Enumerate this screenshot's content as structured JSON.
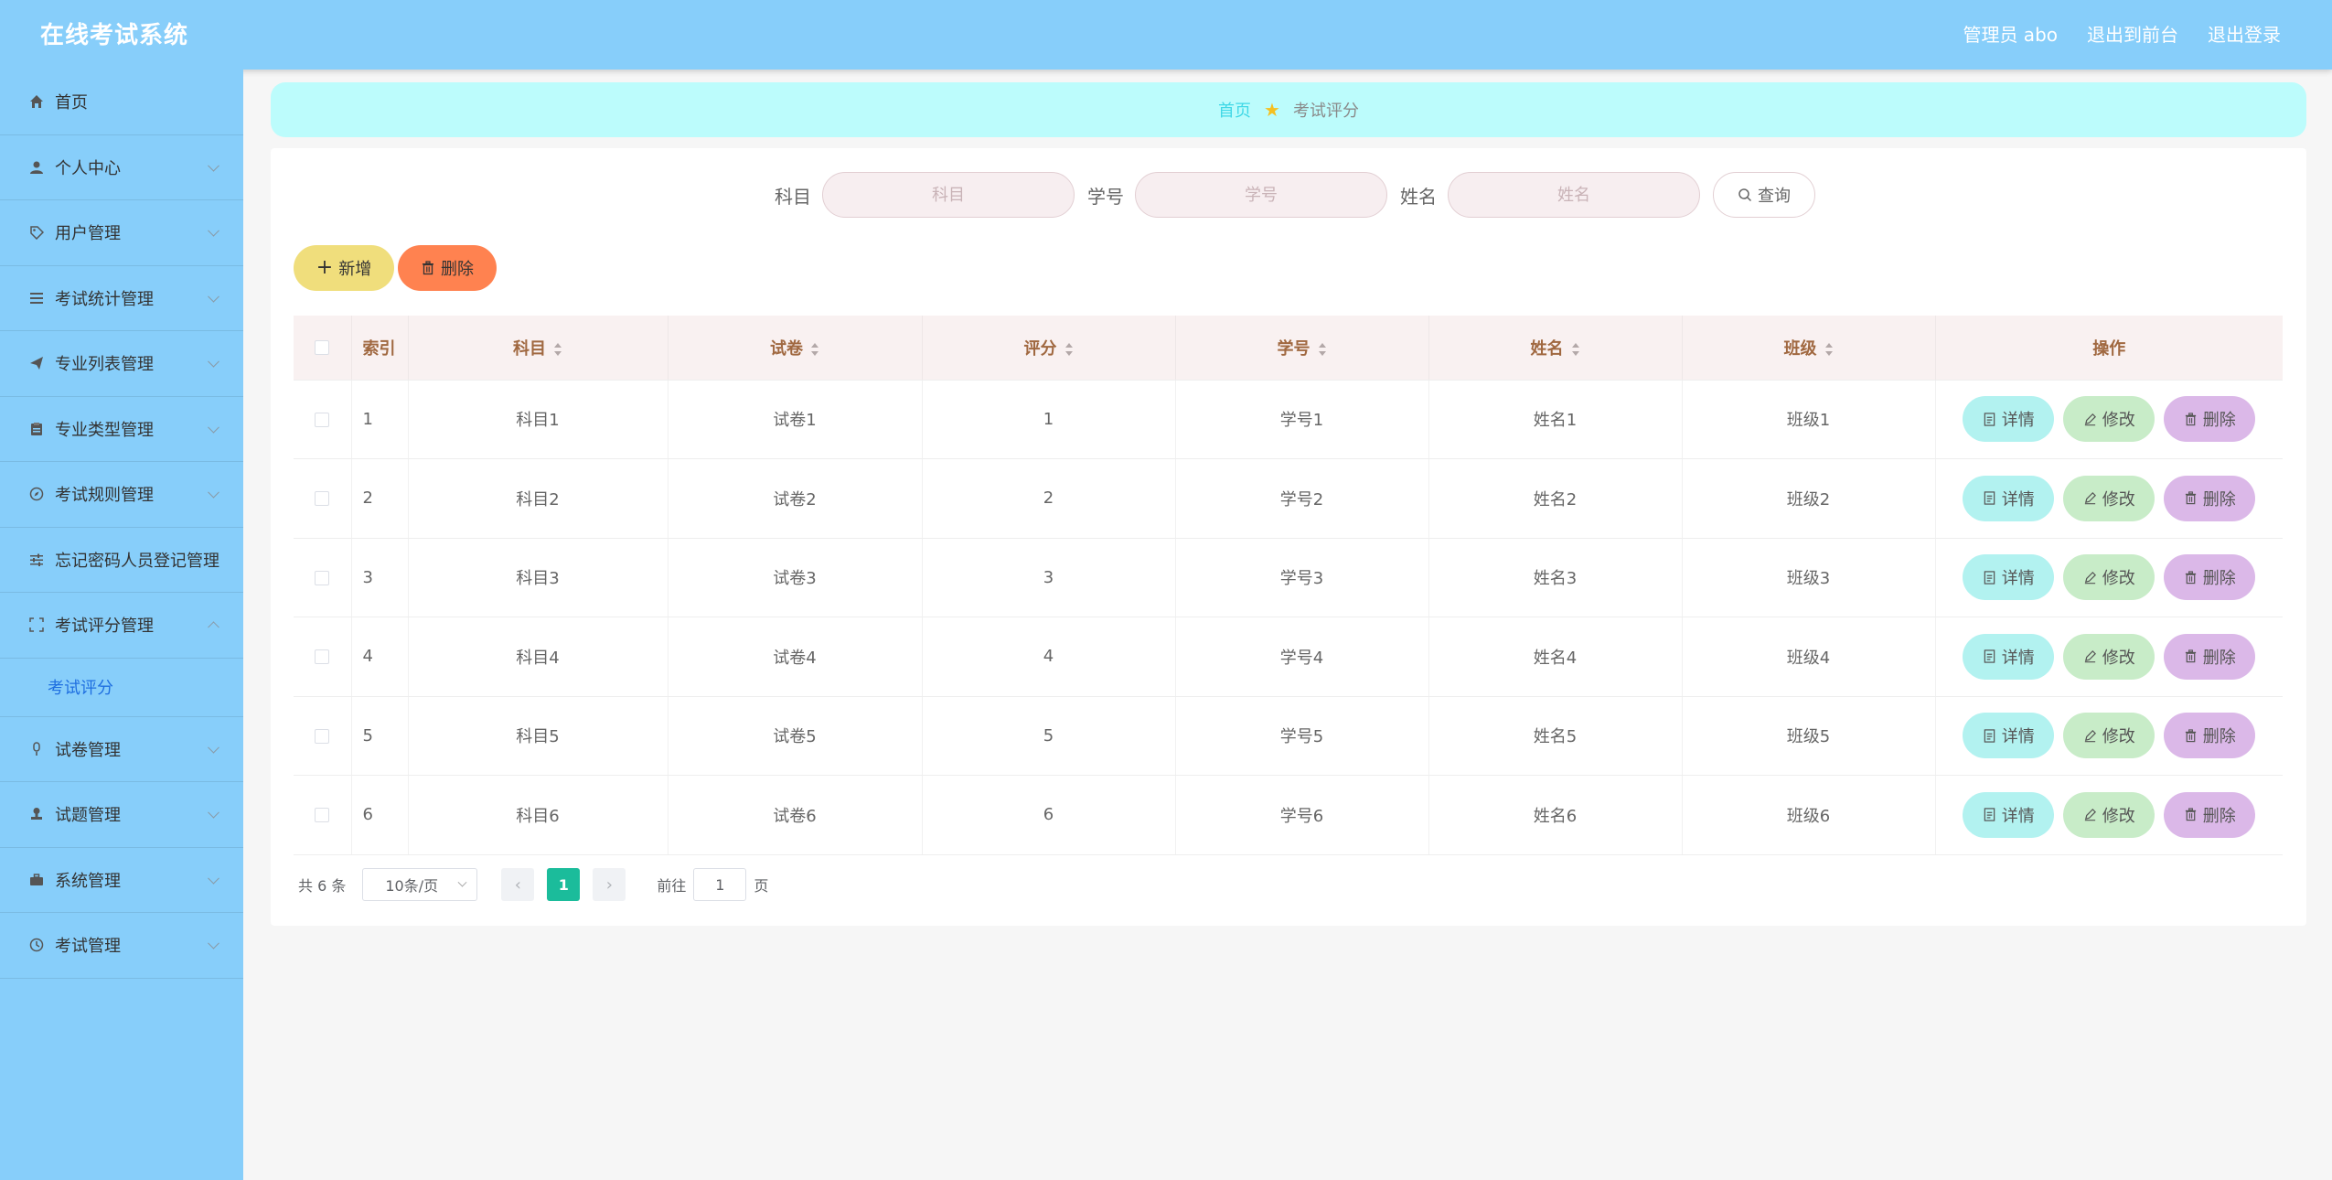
{
  "header": {
    "title": "在线考试系统",
    "admin": "管理员 abo",
    "to_front": "退出到前台",
    "logout": "退出登录"
  },
  "sidebar": {
    "items": [
      {
        "label": "首页",
        "icon": "home-icon",
        "expandable": false
      },
      {
        "label": "个人中心",
        "icon": "user-icon",
        "expandable": true
      },
      {
        "label": "用户管理",
        "icon": "tag-icon",
        "expandable": true
      },
      {
        "label": "考试统计管理",
        "icon": "list-icon",
        "expandable": true
      },
      {
        "label": "专业列表管理",
        "icon": "send-icon",
        "expandable": true
      },
      {
        "label": "专业类型管理",
        "icon": "clipboard-icon",
        "expandable": true
      },
      {
        "label": "考试规则管理",
        "icon": "compass-icon",
        "expandable": true
      },
      {
        "label": "忘记密码人员登记管理",
        "icon": "sliders-icon",
        "expandable": false
      },
      {
        "label": "考试评分管理",
        "icon": "fullscreen-icon",
        "expandable": true,
        "open": true
      },
      {
        "label": "试卷管理",
        "icon": "mic-icon",
        "expandable": true
      },
      {
        "label": "试题管理",
        "icon": "stamp-icon",
        "expandable": true
      },
      {
        "label": "系统管理",
        "icon": "briefcase-icon",
        "expandable": true
      },
      {
        "label": "考试管理",
        "icon": "clock-icon",
        "expandable": true
      }
    ],
    "sub_item": "考试评分"
  },
  "breadcrumb": {
    "home": "首页",
    "current": "考试评分"
  },
  "search": {
    "subject_label": "科目",
    "subject_placeholder": "科目",
    "student_no_label": "学号",
    "student_no_placeholder": "学号",
    "name_label": "姓名",
    "name_placeholder": "姓名",
    "query_button": "查询"
  },
  "toolbar": {
    "add_button": "新增",
    "delete_button": "删除"
  },
  "table": {
    "columns": [
      "索引",
      "科目",
      "试卷",
      "评分",
      "学号",
      "姓名",
      "班级",
      "操作"
    ],
    "rows": [
      {
        "index": "1",
        "subject": "科目1",
        "paper": "试卷1",
        "score": "1",
        "student_no": "学号1",
        "name": "姓名1",
        "class": "班级1"
      },
      {
        "index": "2",
        "subject": "科目2",
        "paper": "试卷2",
        "score": "2",
        "student_no": "学号2",
        "name": "姓名2",
        "class": "班级2"
      },
      {
        "index": "3",
        "subject": "科目3",
        "paper": "试卷3",
        "score": "3",
        "student_no": "学号3",
        "name": "姓名3",
        "class": "班级3"
      },
      {
        "index": "4",
        "subject": "科目4",
        "paper": "试卷4",
        "score": "4",
        "student_no": "学号4",
        "name": "姓名4",
        "class": "班级4"
      },
      {
        "index": "5",
        "subject": "科目5",
        "paper": "试卷5",
        "score": "5",
        "student_no": "学号5",
        "name": "姓名5",
        "class": "班级5"
      },
      {
        "index": "6",
        "subject": "科目6",
        "paper": "试卷6",
        "score": "6",
        "student_no": "学号6",
        "name": "姓名6",
        "class": "班级6"
      }
    ],
    "row_actions": {
      "detail": "详情",
      "edit": "修改",
      "delete": "删除"
    }
  },
  "pagination": {
    "total": "共 6 条",
    "page_size": "10条/页",
    "current_page": "1",
    "goto_prefix": "前往",
    "goto_value": "1",
    "goto_suffix": "页"
  },
  "colors": {
    "header_bg": "#87cefa",
    "sidebar_bg": "#87cefa",
    "breadcrumb_bg": "#bcfcfc",
    "add_button": "#f0de7c",
    "delete_button": "#ff8250",
    "detail_button": "#b2f2f0",
    "edit_button": "#c8ecc8",
    "remove_button": "#dbb8e8",
    "page_active": "#1bbc9b"
  }
}
